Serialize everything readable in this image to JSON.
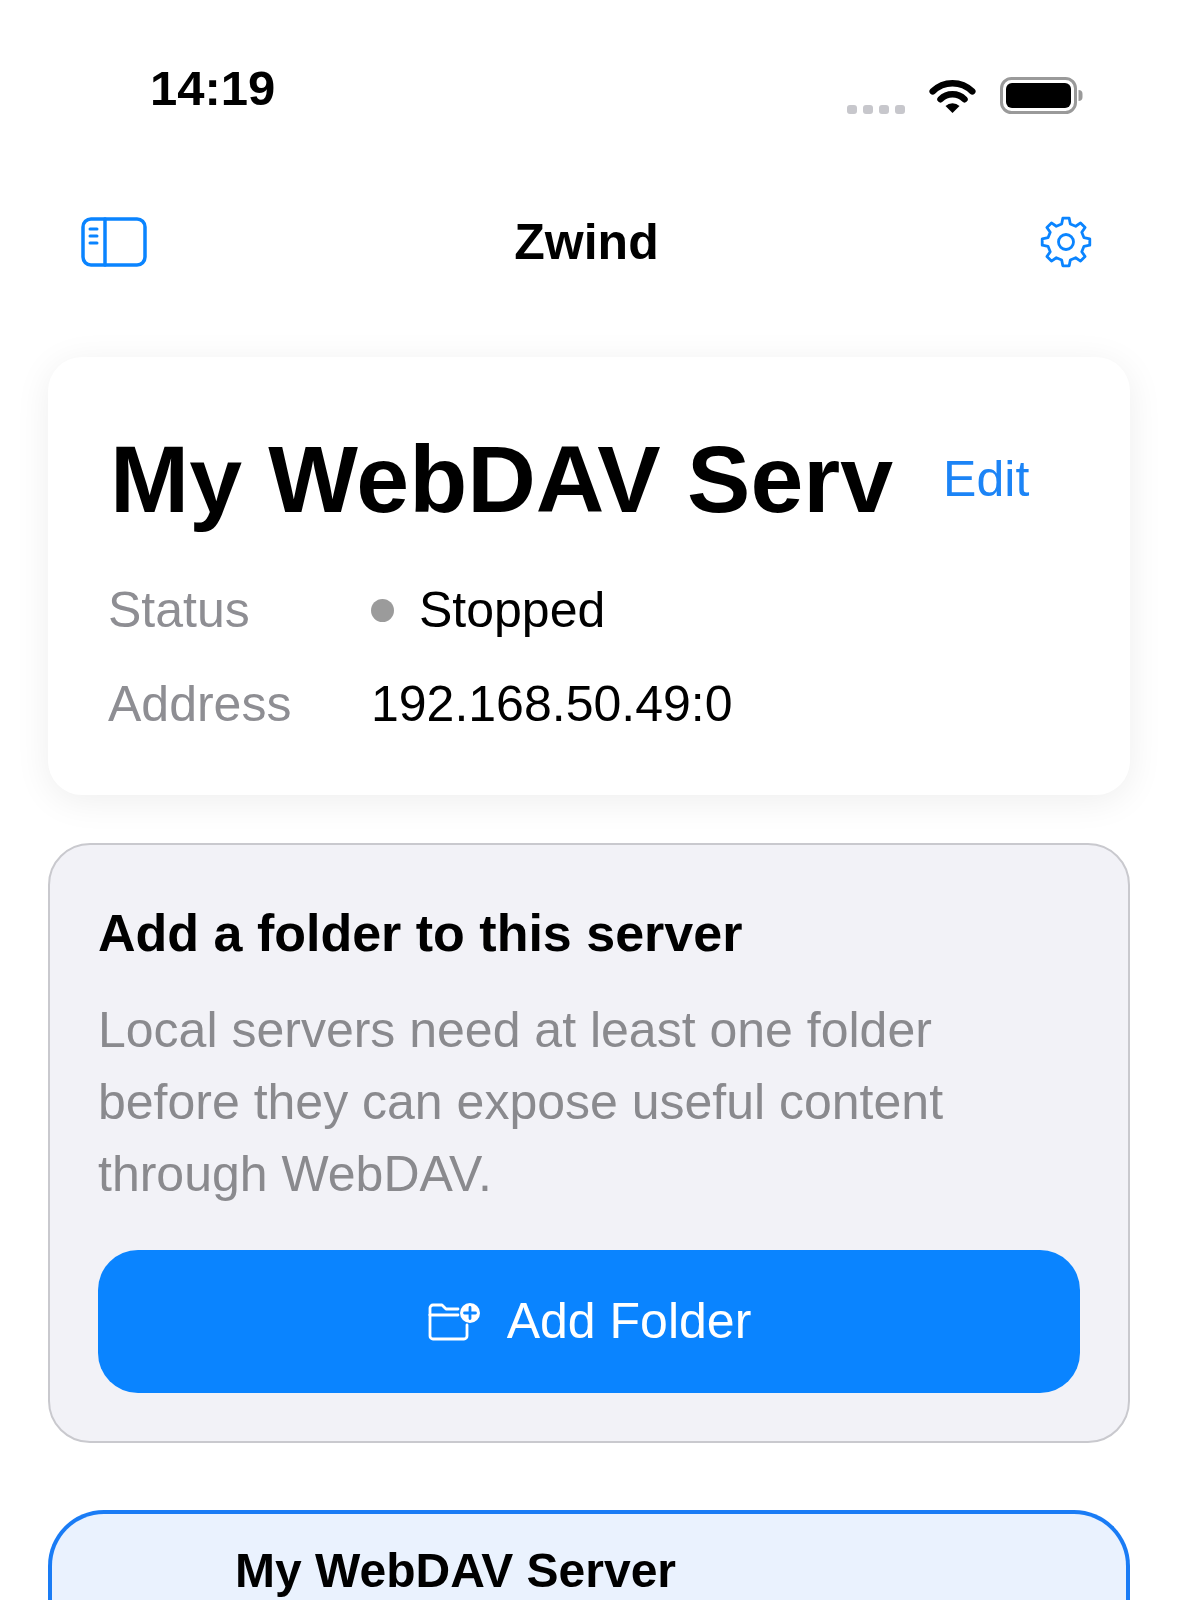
{
  "status_bar": {
    "time": "14:19"
  },
  "nav": {
    "title": "Zwind"
  },
  "server_card": {
    "title": "My WebDAV Serv",
    "edit": "Edit",
    "rows": [
      {
        "kind": "status",
        "label": "Status",
        "value": "Stopped",
        "color": "#9b9b9b"
      },
      {
        "kind": "text",
        "label": "Address",
        "value": "192.168.50.49:0"
      }
    ]
  },
  "folder_prompt": {
    "title": "Add a folder to this server",
    "body": "Local servers need at least one folder before they can expose useful content through WebDAV.",
    "button": "Add Folder"
  },
  "servers": [
    {
      "name": "My WebDAV Server",
      "selected": true
    }
  ]
}
